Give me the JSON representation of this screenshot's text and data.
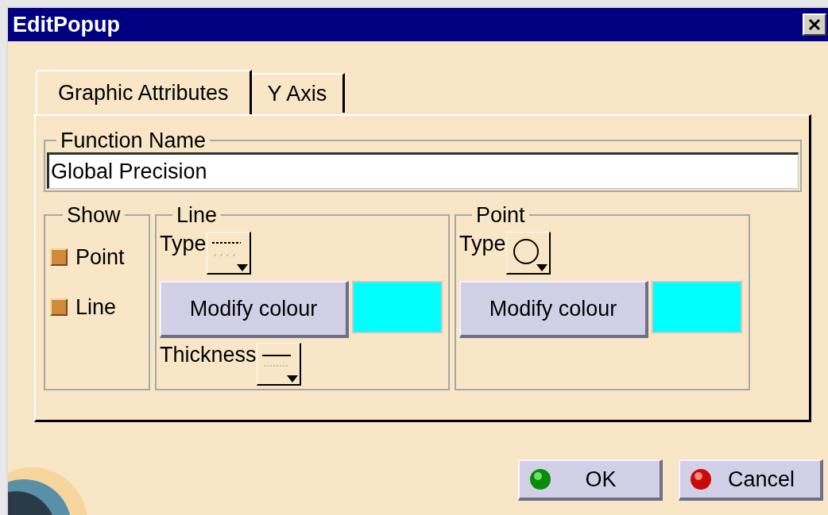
{
  "window": {
    "title": "EditPopup"
  },
  "tabs": [
    {
      "label": "Graphic Attributes",
      "selected": true
    },
    {
      "label": "Y Axis",
      "selected": false
    }
  ],
  "function_name": {
    "label": "Function Name",
    "value": "Global Precision"
  },
  "show": {
    "label": "Show",
    "items": [
      {
        "label": "Point",
        "checked": true
      },
      {
        "label": "Line",
        "checked": true
      }
    ]
  },
  "line": {
    "label": "Line",
    "type_label": "Type",
    "button": "Modify colour",
    "color": "#00ffff",
    "thickness_label": "Thickness"
  },
  "point": {
    "label": "Point",
    "type_label": "Type",
    "button": "Modify colour",
    "color": "#00ffff"
  },
  "buttons": [
    {
      "label": "OK",
      "kind": "ok"
    },
    {
      "label": "Cancel",
      "kind": "cancel"
    }
  ]
}
